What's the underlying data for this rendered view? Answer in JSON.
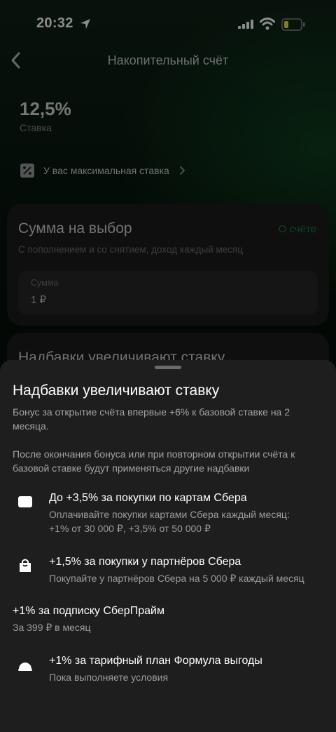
{
  "status_bar": {
    "time": "20:32"
  },
  "header": {
    "title": "Накопительный счёт"
  },
  "rate": {
    "value": "12,5%",
    "label": "Ставка"
  },
  "max_rate_link": "У вас максимальная ставка",
  "amount_card": {
    "title": "Сумма на выбор",
    "link": "О счёте",
    "subtitle": "С пополнением и со снятием, доход каждый месяц",
    "field_label": "Сумма",
    "field_value": "1 ₽"
  },
  "bonus_card": {
    "title": "Надбавки увеличивают ставку"
  },
  "sheet": {
    "title": "Надбавки увеличивают ставку",
    "paragraph1": "Бонус за открытие счёта впервые +6% к базовой ставке на 2 месяца.",
    "paragraph2": "После окончания бонуса или при повторном открытии счёта к базовой ставке будут применяться другие надбавки",
    "items": [
      {
        "icon": "card-icon",
        "title": "До +3,5% за покупки по картам Сбера",
        "desc1": "Оплачивайте покупки картами Сбера каждый месяц:",
        "desc2": "+1% от 30 000 ₽, +3,5% от 50 000 ₽"
      },
      {
        "icon": "shopping-bag-icon",
        "title": "+1,5% за покупки у партнёров Сбера",
        "desc1": "Покупайте у партнёров Сбера на 5 000 ₽ каждый месяц"
      },
      {
        "icon": "",
        "title": "+1% за подписку СберПрайм",
        "desc1": "За 399 ₽ в месяц"
      },
      {
        "icon": "dome-icon",
        "title": "+1% за тарифный план Формула выгоды",
        "desc1": "Пока выполняете условия"
      }
    ]
  },
  "colors": {
    "accent": "#1f7a3c",
    "sheet_bg": "#1e1e1f",
    "card_bg": "#1b1c1b"
  }
}
